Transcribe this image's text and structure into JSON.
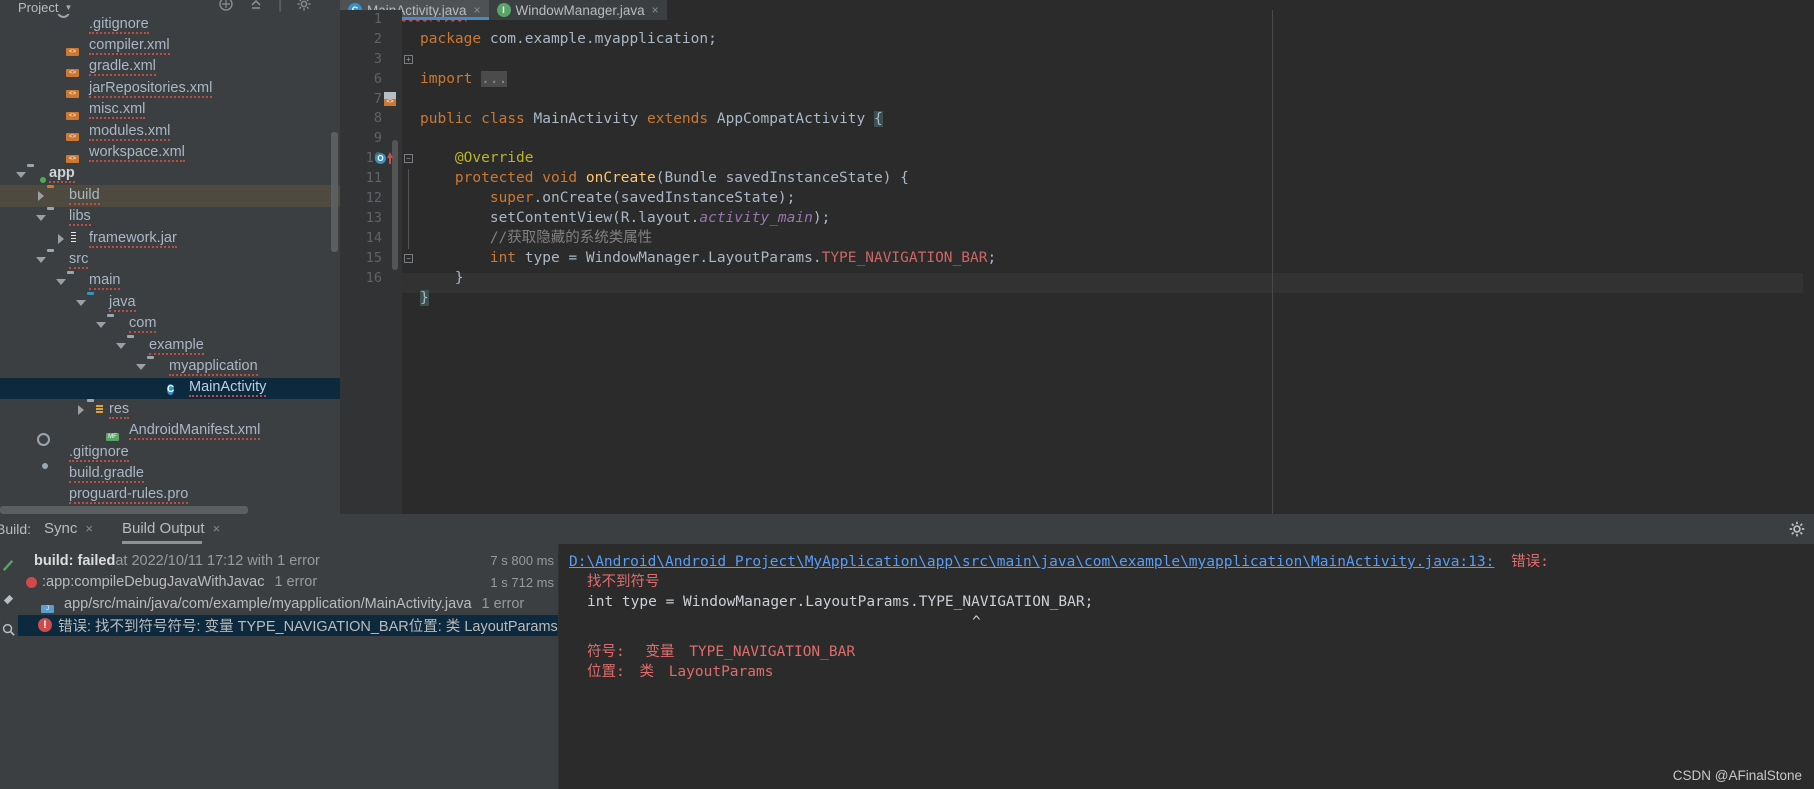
{
  "window": {
    "tool_window_title": "Project",
    "watermark": "CSDN @AFinalStone"
  },
  "project_tree": {
    "items": [
      {
        "label": ".gitignore",
        "indent": 2,
        "arrow": "none",
        "icon": "gitignore-file-icon",
        "state": "normal"
      },
      {
        "label": "compiler.xml",
        "indent": 2,
        "arrow": "none",
        "icon": "xml-file-icon",
        "state": "normal"
      },
      {
        "label": "gradle.xml",
        "indent": 2,
        "arrow": "none",
        "icon": "xml-file-icon",
        "state": "normal"
      },
      {
        "label": "jarRepositories.xml",
        "indent": 2,
        "arrow": "none",
        "icon": "xml-file-icon",
        "state": "normal"
      },
      {
        "label": "misc.xml",
        "indent": 2,
        "arrow": "none",
        "icon": "xml-file-icon",
        "state": "normal"
      },
      {
        "label": "modules.xml",
        "indent": 2,
        "arrow": "none",
        "icon": "xml-file-icon",
        "state": "normal"
      },
      {
        "label": "workspace.xml",
        "indent": 2,
        "arrow": "none",
        "icon": "xml-file-icon",
        "state": "normal"
      },
      {
        "label": "app",
        "indent": 0,
        "arrow": "down",
        "icon": "module-folder-icon",
        "state": "bold"
      },
      {
        "label": "build",
        "indent": 1,
        "arrow": "right",
        "icon": "orange-folder-icon",
        "state": "selected-inactive"
      },
      {
        "label": "libs",
        "indent": 1,
        "arrow": "down",
        "icon": "folder-icon",
        "state": "normal"
      },
      {
        "label": "framework.jar",
        "indent": 2,
        "arrow": "right",
        "icon": "jar-file-icon",
        "state": "normal"
      },
      {
        "label": "src",
        "indent": 1,
        "arrow": "down",
        "icon": "folder-icon",
        "state": "normal"
      },
      {
        "label": "main",
        "indent": 2,
        "arrow": "down",
        "icon": "folder-icon",
        "state": "normal"
      },
      {
        "label": "java",
        "indent": 3,
        "arrow": "down",
        "icon": "source-root-folder-icon",
        "state": "normal"
      },
      {
        "label": "com",
        "indent": 4,
        "arrow": "down",
        "icon": "package-folder-icon",
        "state": "normal"
      },
      {
        "label": "example",
        "indent": 5,
        "arrow": "down",
        "icon": "package-folder-icon",
        "state": "normal"
      },
      {
        "label": "myapplication",
        "indent": 6,
        "arrow": "down",
        "icon": "package-folder-icon",
        "state": "normal"
      },
      {
        "label": "MainActivity",
        "indent": 7,
        "arrow": "none",
        "icon": "java-class-icon",
        "state": "selected-active"
      },
      {
        "label": "res",
        "indent": 3,
        "arrow": "right",
        "icon": "res-folder-icon",
        "state": "normal"
      },
      {
        "label": "AndroidManifest.xml",
        "indent": 4,
        "arrow": "none",
        "icon": "manifest-file-icon",
        "state": "normal"
      },
      {
        "label": ".gitignore",
        "indent": 1,
        "arrow": "none",
        "icon": "gitignore-file-icon",
        "state": "normal"
      },
      {
        "label": "build.gradle",
        "indent": 1,
        "arrow": "none",
        "icon": "gradle-file-icon",
        "state": "normal"
      },
      {
        "label": "proguard-rules.pro",
        "indent": 1,
        "arrow": "none",
        "icon": "pro-file-icon",
        "state": "normal"
      }
    ]
  },
  "editor": {
    "tabs": [
      {
        "label": "MainActivity.java",
        "icon": "java-class-icon",
        "active": true,
        "error": true
      },
      {
        "label": "WindowManager.java",
        "icon": "interface-icon",
        "active": false,
        "error": false
      }
    ],
    "line_numbers": [
      "1",
      "2",
      "3",
      "6",
      "7",
      "8",
      "9",
      "10",
      "11",
      "12",
      "13",
      "14",
      "15",
      "16"
    ],
    "lines": [
      "package com.example.myapplication;",
      "",
      "import ...",
      "",
      "public class MainActivity extends AppCompatActivity {",
      "",
      "    @Override",
      "    protected void onCreate(Bundle savedInstanceState) {",
      "        super.onCreate(savedInstanceState);",
      "        setContentView(R.layout.activity_main);",
      "        //获取隐藏的系统类属性",
      "        int type = WindowManager.LayoutParams.TYPE_NAVIGATION_BAR;",
      "    }",
      "}"
    ]
  },
  "build": {
    "panel_label": "Build:",
    "tabs": [
      {
        "label": "Sync",
        "active": false
      },
      {
        "label": "Build Output",
        "active": true
      }
    ],
    "tree": [
      {
        "icon": "error-run-icon",
        "text_bold": "build: failed",
        "text_rest": " at 2022/10/11 17:12 with 1 error",
        "time": "7 s 800 ms",
        "selected": false
      },
      {
        "icon": "task-error-icon",
        "text_bold": "",
        "text_rest": ":app:compileDebugJavaWithJavac",
        "count": "1 error",
        "time": "1 s 712 ms",
        "selected": false
      },
      {
        "icon": "java-file-icon",
        "text_bold": "",
        "text_rest": "app/src/main/java/com/example/myapplication/MainActivity.java",
        "count": "1 error",
        "time": "",
        "selected": false
      },
      {
        "icon": "error-icon",
        "text_bold": "",
        "text_rest": "错误: 找不到符号符号:  变量 TYPE_NAVIGATION_BAR位置: 类 LayoutParams",
        "count": "",
        "time": "",
        "selected": true
      }
    ],
    "detail": {
      "path_link": "D:\\Android\\Android Project\\MyApplication\\app\\src\\main\\java\\com\\example\\myapplication\\MainActivity.java:13:",
      "error_word": "错误:",
      "message": "找不到符号",
      "code_line": "        int type = WindowManager.LayoutParams.TYPE_NAVIGATION_BAR;",
      "caret": "^",
      "symbol_label": "符号:",
      "symbol_kind": "变量",
      "symbol_value": "TYPE_NAVIGATION_BAR",
      "location_label": "位置:",
      "location_kind": "类",
      "location_value": "LayoutParams"
    }
  },
  "colors": {
    "accent_blue": "#4a88c7",
    "error_red": "#cc4b4b",
    "selection_blue": "#0d293e",
    "link_blue": "#589df6"
  }
}
